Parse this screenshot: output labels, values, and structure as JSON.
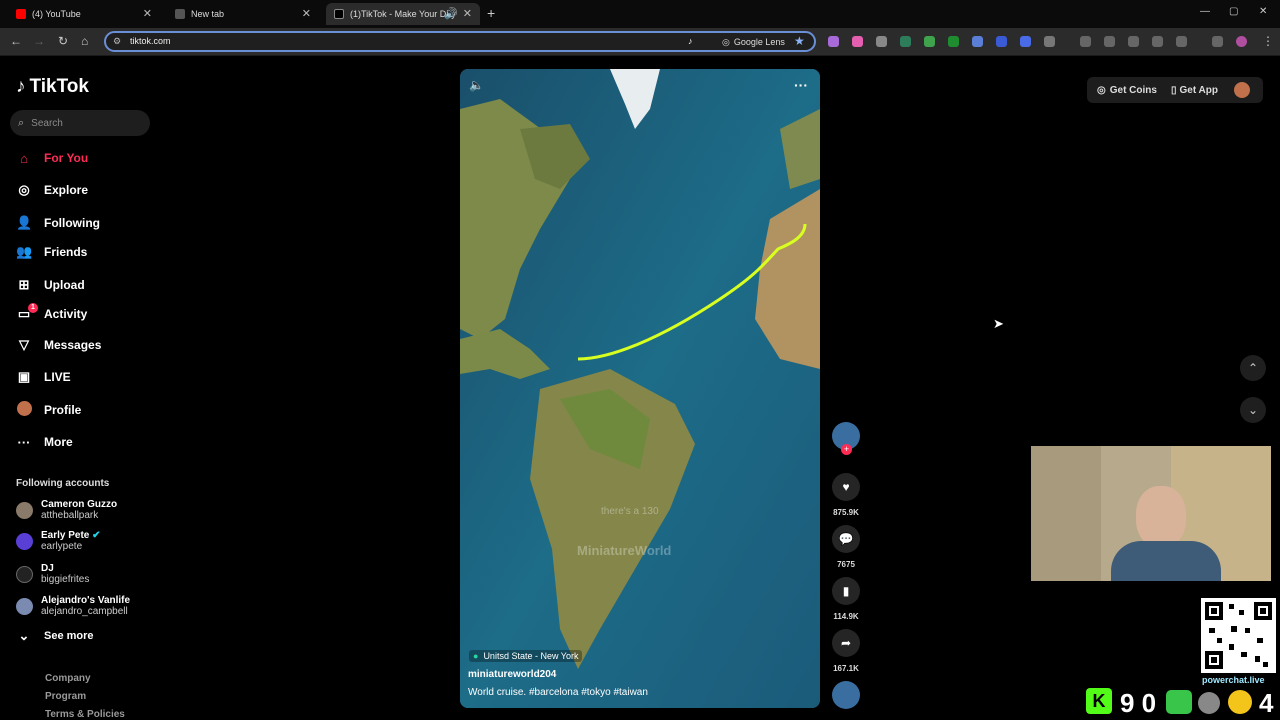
{
  "browser": {
    "tabs": [
      {
        "title": "(4) YouTube"
      },
      {
        "title": "New tab"
      },
      {
        "title": "(1)TikTok - Make Your Day"
      }
    ],
    "url": "tiktok.com",
    "google_lens": "Google Lens"
  },
  "tiktok": {
    "logo": "TikTok",
    "search_placeholder": "Search",
    "nav": [
      {
        "label": "For You",
        "icon": "home-icon",
        "active": true
      },
      {
        "label": "Explore",
        "icon": "compass-icon"
      },
      {
        "label": "Following",
        "icon": "following-icon"
      },
      {
        "label": "Friends",
        "icon": "friends-icon"
      },
      {
        "label": "Upload",
        "icon": "upload-icon"
      },
      {
        "label": "Activity",
        "icon": "activity-icon",
        "badge": "1"
      },
      {
        "label": "Messages",
        "icon": "messages-icon"
      },
      {
        "label": "LIVE",
        "icon": "live-icon"
      },
      {
        "label": "Profile",
        "icon": "profile-avatar"
      },
      {
        "label": "More",
        "icon": "more-icon"
      }
    ],
    "following_title": "Following accounts",
    "accounts": [
      {
        "name": "Cameron Guzzo",
        "handle": "attheballpark"
      },
      {
        "name": "Early Pete",
        "handle": "earlypete"
      },
      {
        "name": "DJ",
        "handle": "biggiefrites"
      },
      {
        "name": "Alejandro's Vanlife",
        "handle": "alejandro_campbell"
      }
    ],
    "see_more": "See more",
    "footer": [
      "Company",
      "Program",
      "Terms & Policies"
    ],
    "top_right": {
      "coins": "Get Coins",
      "app": "Get App"
    },
    "video": {
      "location": "Unitsd State - New York",
      "author": "miniatureworld204",
      "caption": "World cruise. #barcelona #tokyo #taiwan",
      "subtitle": "there's a 130",
      "watermark": "MiniatureWorld"
    },
    "stats": {
      "likes": "875.9K",
      "comments": "7675",
      "saves": "114.9K",
      "shares": "167.1K"
    }
  },
  "overlay": {
    "powerchat": "powerchat.live",
    "counter": "9 0",
    "right_num": "4"
  }
}
